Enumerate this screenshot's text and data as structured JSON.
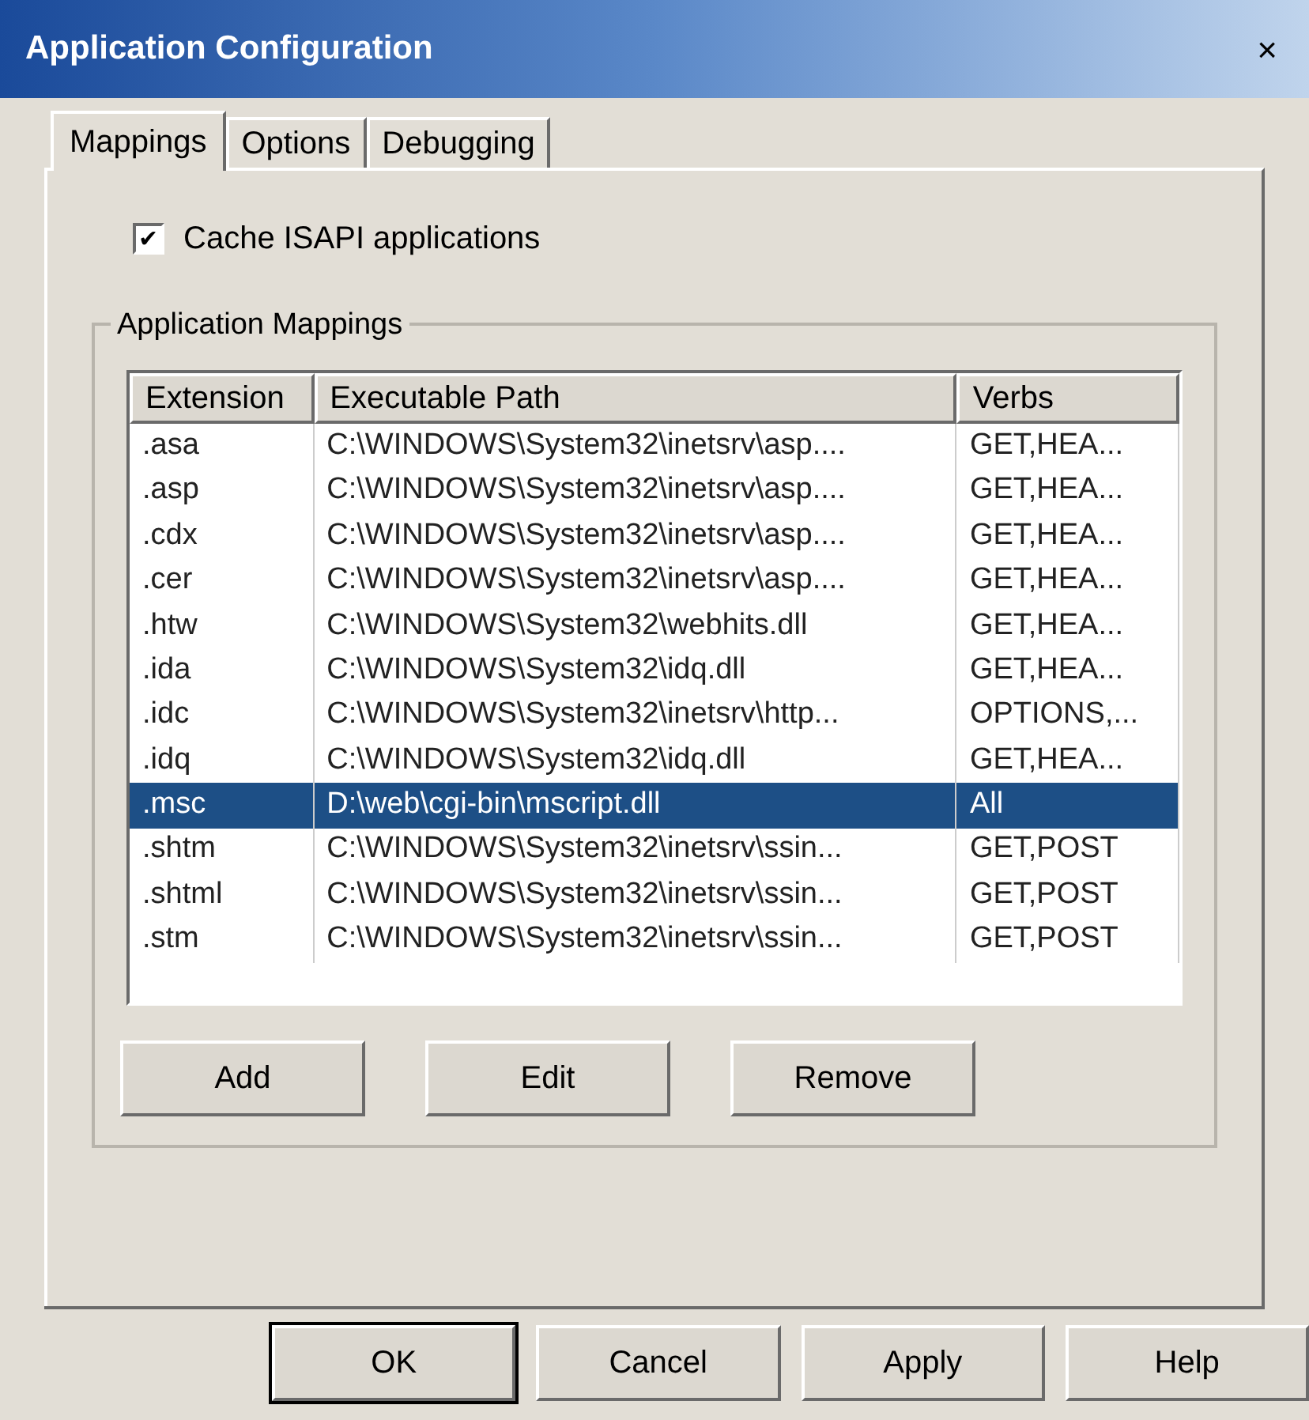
{
  "window": {
    "title": "Application Configuration",
    "close": "×"
  },
  "tabs": [
    {
      "label": "Mappings",
      "selected": true
    },
    {
      "label": "Options",
      "selected": false
    },
    {
      "label": "Debugging",
      "selected": false
    }
  ],
  "cache_checkbox": {
    "label": "Cache ISAPI applications",
    "checked": true,
    "mark": "✔"
  },
  "group": {
    "title": "Application Mappings"
  },
  "table": {
    "columns": [
      "Extension",
      "Executable Path",
      "Verbs"
    ],
    "rows": [
      {
        "cells": [
          ".asa",
          "C:\\WINDOWS\\System32\\inetsrv\\asp....",
          "GET,HEA..."
        ],
        "selected": false
      },
      {
        "cells": [
          ".asp",
          "C:\\WINDOWS\\System32\\inetsrv\\asp....",
          "GET,HEA..."
        ],
        "selected": false
      },
      {
        "cells": [
          ".cdx",
          "C:\\WINDOWS\\System32\\inetsrv\\asp....",
          "GET,HEA..."
        ],
        "selected": false
      },
      {
        "cells": [
          ".cer",
          "C:\\WINDOWS\\System32\\inetsrv\\asp....",
          "GET,HEA..."
        ],
        "selected": false
      },
      {
        "cells": [
          ".htw",
          "C:\\WINDOWS\\System32\\webhits.dll",
          "GET,HEA..."
        ],
        "selected": false
      },
      {
        "cells": [
          ".ida",
          "C:\\WINDOWS\\System32\\idq.dll",
          "GET,HEA..."
        ],
        "selected": false
      },
      {
        "cells": [
          ".idc",
          "C:\\WINDOWS\\System32\\inetsrv\\http...",
          "OPTIONS,..."
        ],
        "selected": false
      },
      {
        "cells": [
          ".idq",
          "C:\\WINDOWS\\System32\\idq.dll",
          "GET,HEA..."
        ],
        "selected": false
      },
      {
        "cells": [
          ".msc",
          "D:\\web\\cgi-bin\\mscript.dll",
          "All"
        ],
        "selected": true
      },
      {
        "cells": [
          ".shtm",
          "C:\\WINDOWS\\System32\\inetsrv\\ssin...",
          "GET,POST"
        ],
        "selected": false
      },
      {
        "cells": [
          ".shtml",
          "C:\\WINDOWS\\System32\\inetsrv\\ssin...",
          "GET,POST"
        ],
        "selected": false
      },
      {
        "cells": [
          ".stm",
          "C:\\WINDOWS\\System32\\inetsrv\\ssin...",
          "GET,POST"
        ],
        "selected": false
      }
    ]
  },
  "group_buttons": [
    "Add",
    "Edit",
    "Remove"
  ],
  "dialog_buttons": [
    {
      "label": "OK",
      "default": true
    },
    {
      "label": "Cancel",
      "default": false
    },
    {
      "label": "Apply",
      "default": false
    },
    {
      "label": "Help",
      "default": false
    }
  ]
}
